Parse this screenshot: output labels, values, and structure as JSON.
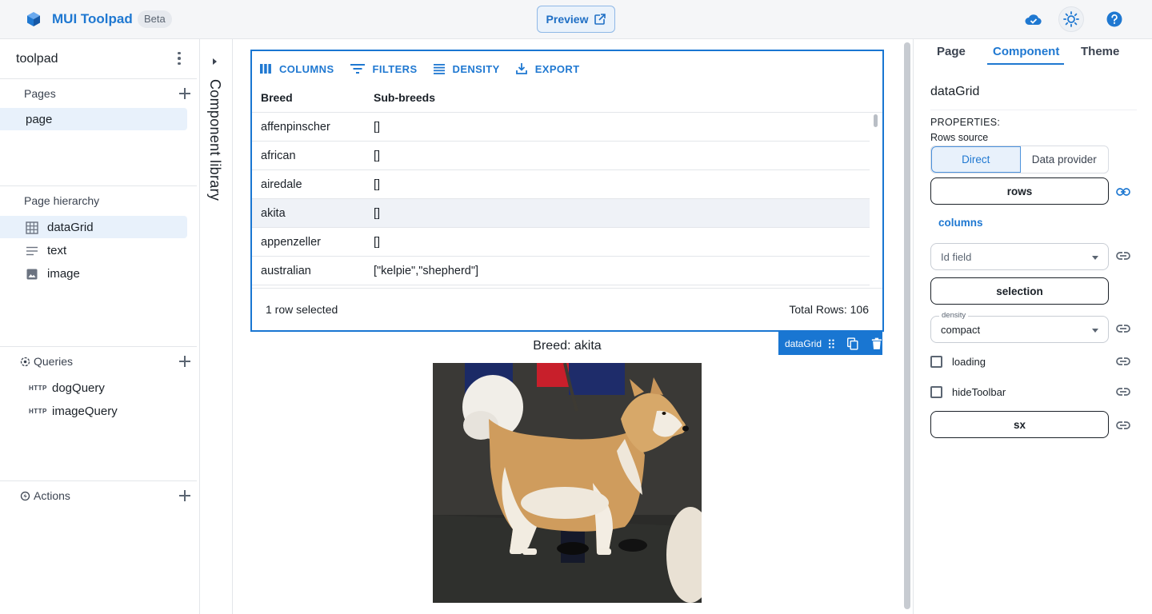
{
  "topbar": {
    "app_title": "MUI Toolpad",
    "badge": "Beta",
    "preview_label": "Preview"
  },
  "left": {
    "project_name": "toolpad",
    "pages_title": "Pages",
    "pages": [
      "page"
    ],
    "hierarchy_title": "Page hierarchy",
    "hierarchy": [
      {
        "label": "dataGrid",
        "icon": "grid-icon"
      },
      {
        "label": "text",
        "icon": "text-icon"
      },
      {
        "label": "image",
        "icon": "image-icon"
      }
    ],
    "queries_title": "Queries",
    "queries": [
      {
        "type": "HTTP",
        "label": "dogQuery"
      },
      {
        "type": "HTTP",
        "label": "imageQuery"
      }
    ],
    "actions_title": "Actions"
  },
  "library": {
    "label": "Component library"
  },
  "grid": {
    "toolbar": {
      "columns": "COLUMNS",
      "filters": "FILTERS",
      "density": "DENSITY",
      "export": "EXPORT"
    },
    "columns": [
      "Breed",
      "Sub-breeds"
    ],
    "rows": [
      [
        "affenpinscher",
        "[]"
      ],
      [
        "african",
        "[]"
      ],
      [
        "airedale",
        "[]"
      ],
      [
        "akita",
        "[]"
      ],
      [
        "appenzeller",
        "[]"
      ],
      [
        "australian",
        "[\"kelpie\",\"shepherd\"]"
      ]
    ],
    "selected_row": "akita",
    "footer_left": "1 row selected",
    "footer_right": "Total Rows: 106",
    "tag_label": "dataGrid"
  },
  "canvas": {
    "breed_text": "Breed: akita"
  },
  "right": {
    "tabs": [
      "Page",
      "Component",
      "Theme"
    ],
    "active_tab": "Component",
    "component_name": "dataGrid",
    "properties_title": "PROPERTIES:",
    "rows_source_label": "Rows source",
    "rows_source_options": [
      "Direct",
      "Data provider"
    ],
    "rows_source_selected": "Direct",
    "rows_btn": "rows",
    "columns_link": "columns",
    "id_field_placeholder": "Id field",
    "selection_btn": "selection",
    "density_label": "density",
    "density_value": "compact",
    "loading_label": "loading",
    "hide_toolbar_label": "hideToolbar",
    "sx_btn": "sx"
  },
  "colors": {
    "accent": "#1f78d1",
    "selection": "#1976d2"
  }
}
